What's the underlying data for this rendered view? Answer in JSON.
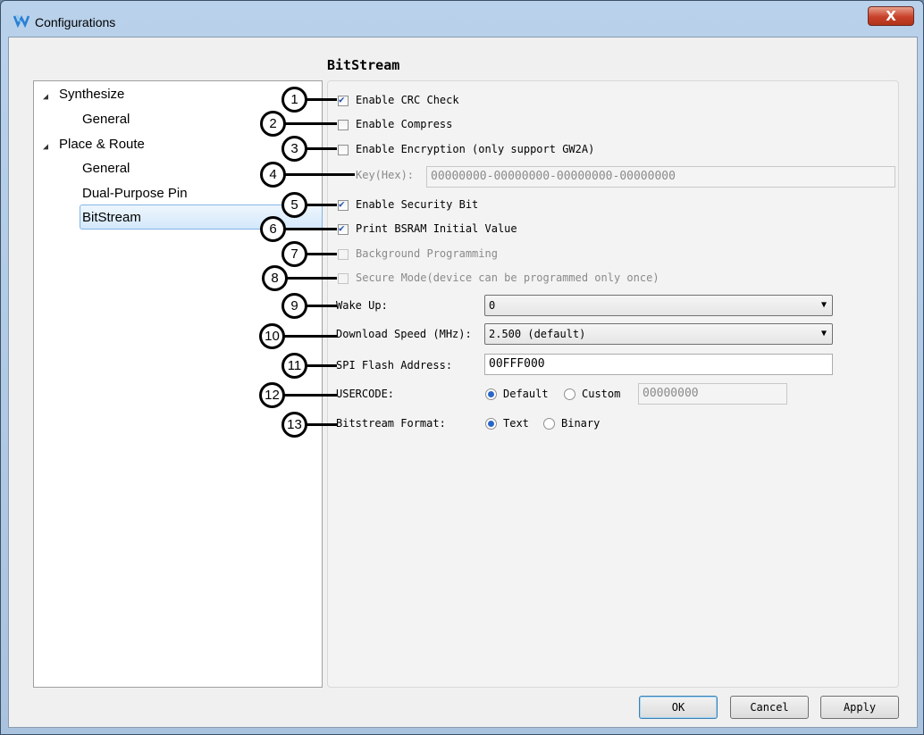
{
  "window": {
    "title": "Configurations",
    "close_glyph": "X"
  },
  "page_heading": "BitStream",
  "tree": {
    "items": [
      {
        "label": "Synthesize",
        "expanded": true
      },
      {
        "label": "General"
      },
      {
        "label": "Place & Route",
        "expanded": true
      },
      {
        "label": "General"
      },
      {
        "label": "Dual-Purpose Pin"
      },
      {
        "label": "BitStream",
        "selected": true
      }
    ]
  },
  "options": {
    "crc": {
      "label": "Enable CRC Check",
      "checked": true
    },
    "compress": {
      "label": "Enable Compress",
      "checked": false
    },
    "encryption": {
      "label": "Enable Encryption (only support GW2A)",
      "checked": false
    },
    "key": {
      "label": "Key(Hex):",
      "value": "00000000-00000000-00000000-00000000"
    },
    "security": {
      "label": "Enable Security Bit",
      "checked": true
    },
    "bsram": {
      "label": "Print BSRAM Initial Value",
      "checked": true
    },
    "background": {
      "label": "Background Programming",
      "checked": false,
      "disabled": true
    },
    "secure_mode": {
      "label": "Secure Mode(device can be programmed only once)",
      "checked": false,
      "disabled": true
    },
    "wake_up": {
      "label": "Wake Up:",
      "value": "0"
    },
    "download_speed": {
      "label": "Download Speed (MHz):",
      "value": "2.500 (default)"
    },
    "spi_flash": {
      "label": "SPI Flash Address:",
      "value": "00FFF000"
    },
    "usercode": {
      "label": "USERCODE:",
      "opt_default": "Default",
      "opt_custom": "Custom",
      "selected": "Default",
      "custom_value": "00000000"
    },
    "bitstream_format": {
      "label": "Bitstream Format:",
      "opt_text": "Text",
      "opt_binary": "Binary",
      "selected": "Text"
    }
  },
  "callouts": [
    "1",
    "2",
    "3",
    "4",
    "5",
    "6",
    "7",
    "8",
    "9",
    "10",
    "11",
    "12",
    "13"
  ],
  "buttons": {
    "ok": "OK",
    "cancel": "Cancel",
    "apply": "Apply"
  },
  "icons": {
    "app": "gowin-logo-icon",
    "close": "close-icon",
    "tree_expand": "expand-arrow-icon",
    "dropdown": "chevron-down-icon"
  }
}
